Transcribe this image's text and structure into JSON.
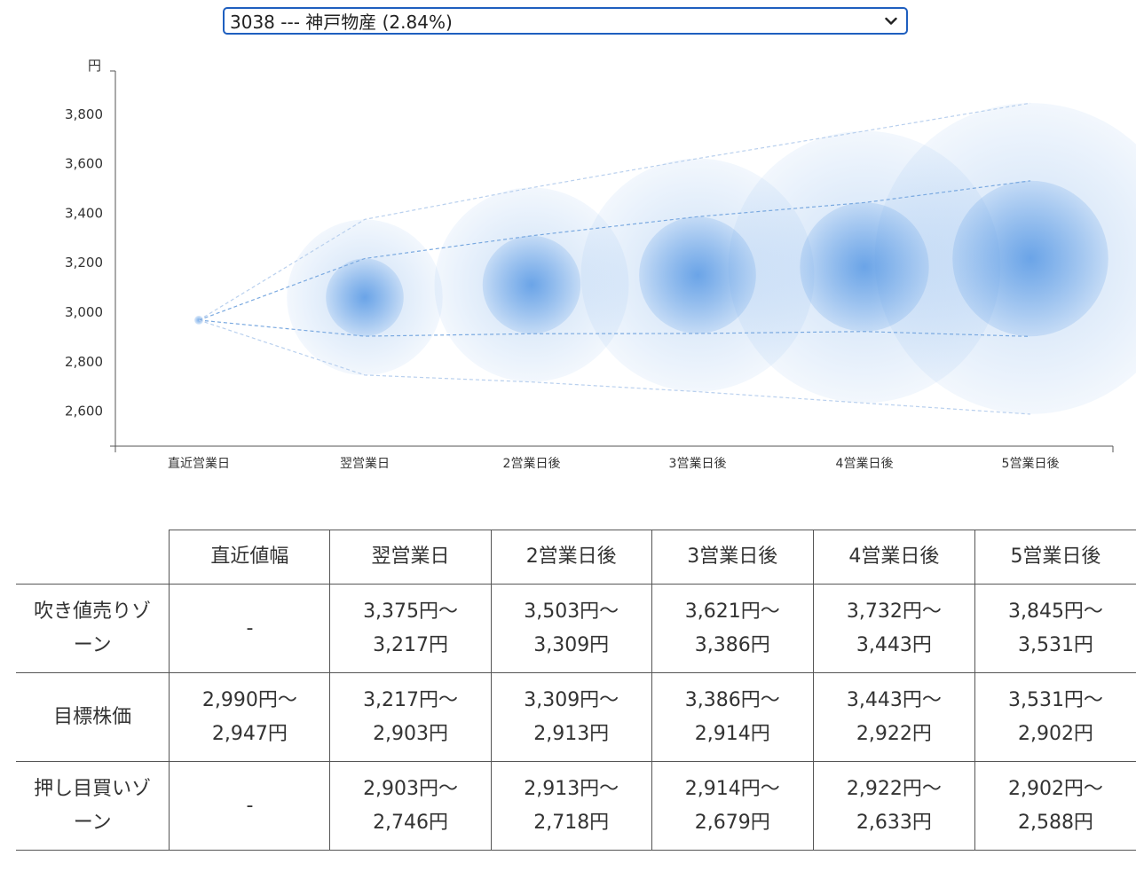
{
  "selector": {
    "value": "3038 --- 神戸物産 (2.84%)"
  },
  "chart_data": {
    "type": "scatter",
    "y_unit_label": "円",
    "ylim": [
      2500,
      4000
    ],
    "yticks": [
      2600,
      2800,
      3000,
      3200,
      3400,
      3600,
      3800
    ],
    "ytick_labels": [
      "2,600",
      "2,800",
      "3,000",
      "3,200",
      "3,400",
      "3,600",
      "3,800"
    ],
    "categories": [
      "直近営業日",
      "翌営業日",
      "2営業日後",
      "3営業日後",
      "4営業日後",
      "5営業日後"
    ],
    "grid": false,
    "lines": [
      {
        "role": "upper-outer",
        "values": [
          2968,
          3375,
          3503,
          3621,
          3732,
          3845
        ]
      },
      {
        "role": "upper-inner",
        "values": [
          2968,
          3217,
          3309,
          3386,
          3443,
          3531
        ]
      },
      {
        "role": "lower-inner",
        "values": [
          2968,
          2903,
          2913,
          2914,
          2922,
          2902
        ]
      },
      {
        "role": "lower-outer",
        "values": [
          2968,
          2746,
          2718,
          2679,
          2633,
          2588
        ]
      }
    ],
    "bubbles": [
      {
        "center": 2968,
        "inner_range": [
          2968,
          2968
        ],
        "outer_range": [
          2968,
          2968
        ]
      },
      {
        "center": 3060,
        "inner_range": [
          2903,
          3217
        ],
        "outer_range": [
          2746,
          3375
        ]
      },
      {
        "center": 3111,
        "inner_range": [
          2913,
          3309
        ],
        "outer_range": [
          2718,
          3503
        ]
      },
      {
        "center": 3150,
        "inner_range": [
          2914,
          3386
        ],
        "outer_range": [
          2679,
          3621
        ]
      },
      {
        "center": 3183,
        "inner_range": [
          2922,
          3443
        ],
        "outer_range": [
          2633,
          3732
        ]
      },
      {
        "center": 3217,
        "inner_range": [
          2902,
          3531
        ],
        "outer_range": [
          2588,
          3845
        ]
      }
    ],
    "colors": {
      "line": "#7aa9e0",
      "bubble": "#4a90e2",
      "axis": "#555555"
    }
  },
  "table": {
    "headers": [
      "",
      "直近値幅",
      "翌営業日",
      "2営業日後",
      "3営業日後",
      "4営業日後",
      "5営業日後"
    ],
    "rows": [
      {
        "label": [
          "吹き値売りゾ",
          "ーン"
        ],
        "cells": [
          [
            "-"
          ],
          [
            "3,375円〜",
            "3,217円"
          ],
          [
            "3,503円〜",
            "3,309円"
          ],
          [
            "3,621円〜",
            "3,386円"
          ],
          [
            "3,732円〜",
            "3,443円"
          ],
          [
            "3,845円〜",
            "3,531円"
          ]
        ]
      },
      {
        "label": [
          "目標株価"
        ],
        "cells": [
          [
            "2,990円〜",
            "2,947円"
          ],
          [
            "3,217円〜",
            "2,903円"
          ],
          [
            "3,309円〜",
            "2,913円"
          ],
          [
            "3,386円〜",
            "2,914円"
          ],
          [
            "3,443円〜",
            "2,922円"
          ],
          [
            "3,531円〜",
            "2,902円"
          ]
        ]
      },
      {
        "label": [
          "押し目買いゾ",
          "ーン"
        ],
        "cells": [
          [
            "-"
          ],
          [
            "2,903円〜",
            "2,746円"
          ],
          [
            "2,913円〜",
            "2,718円"
          ],
          [
            "2,914円〜",
            "2,679円"
          ],
          [
            "2,922円〜",
            "2,633円"
          ],
          [
            "2,902円〜",
            "2,588円"
          ]
        ]
      }
    ]
  }
}
